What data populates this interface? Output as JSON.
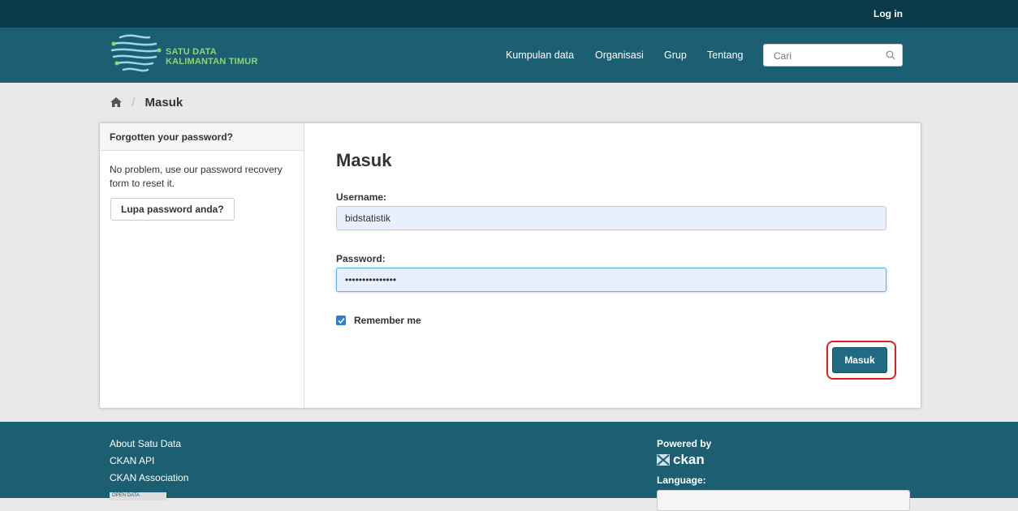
{
  "header": {
    "login_label": "Log in",
    "logo": {
      "line1": "SATU DATA",
      "line2": "KALIMANTAN TIMUR"
    },
    "nav": [
      "Kumpulan data",
      "Organisasi",
      "Grup",
      "Tentang"
    ],
    "search_placeholder": "Cari"
  },
  "breadcrumb": {
    "current": "Masuk"
  },
  "sidebar": {
    "heading": "Forgotten your password?",
    "text": "No problem, use our password recovery form to reset it.",
    "button_label": "Lupa password anda?"
  },
  "form": {
    "title": "Masuk",
    "username_label": "Username:",
    "username_value": "bidstatistik",
    "password_label": "Password:",
    "password_value": "•••••••••••••••",
    "remember_label": "Remember me",
    "remember_checked": true,
    "submit_label": "Masuk"
  },
  "footer": {
    "links": [
      "About Satu Data",
      "CKAN API",
      "CKAN Association"
    ],
    "badge_text": "OPEN DATA",
    "powered_by": "Powered by",
    "ckan_brand": "ckan",
    "language_label": "Language:"
  },
  "colors": {
    "topbar": "#0a3a4a",
    "masthead": "#1d5f72",
    "button": "#206b82",
    "highlight": "#e02020"
  }
}
